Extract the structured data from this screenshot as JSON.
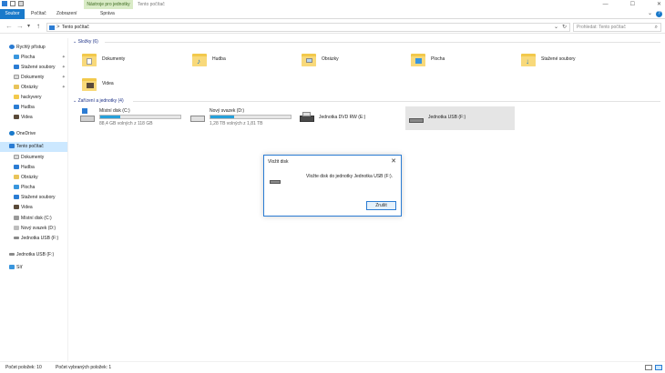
{
  "window": {
    "ribbon_context": "Nástroje pro jednotky",
    "title": "Tento počítač",
    "controls": [
      "—",
      "☐",
      "✕"
    ]
  },
  "ribbon": {
    "tabs": [
      "Soubor",
      "Počítač",
      "Zobrazení",
      "Správa"
    ],
    "help": "?"
  },
  "nav": {
    "back": "←",
    "forward": "→",
    "recent": "▾",
    "up": "↑",
    "address_sep": ">",
    "address": "Tento počítač",
    "refresh": "↻",
    "dropdown": "⌄",
    "search_placeholder": "Prohledat: Tento počítač",
    "search_icon": "⌕"
  },
  "sidebar": {
    "quick_access": "Rychlý přístup",
    "quick_items": [
      {
        "label": "Plocha",
        "pinned": true
      },
      {
        "label": "Stažené soubory",
        "pinned": true
      },
      {
        "label": "Dokumenty",
        "pinned": true
      },
      {
        "label": "Obrázky",
        "pinned": true
      },
      {
        "label": "hackyvery",
        "pinned": false
      },
      {
        "label": "Hudba",
        "pinned": false
      },
      {
        "label": "Videa",
        "pinned": false
      }
    ],
    "onedrive": "OneDrive",
    "this_pc": "Tento počítač",
    "pc_items": [
      "Dokumenty",
      "Hudba",
      "Obrázky",
      "Plocha",
      "Stažené soubory",
      "Videa",
      "Místní disk (C:)",
      "Nový svazek (D:)",
      "Jednotka USB (F:)"
    ],
    "usb": "Jednotka USB (F:)",
    "network": "Síť",
    "pin_glyph": "✦"
  },
  "content": {
    "folders_header": "Složky (6)",
    "folders": [
      "Dokumenty",
      "Hudba",
      "Obrázky",
      "Plocha",
      "Stažené soubory",
      "Videa"
    ],
    "drives_header": "Zařízení a jednotky (4)",
    "drives": [
      {
        "name": "Místní disk (C:)",
        "free": "88,4 GB volných z 118 GB",
        "used_fraction": 0.25
      },
      {
        "name": "Nový svazek (D:)",
        "free": "1,28 TB volných z 1,81 TB",
        "used_fraction": 0.29
      },
      {
        "name": "Jednotka DVD RW (E:)"
      },
      {
        "name": "Jednotka USB (F:)"
      }
    ]
  },
  "dialog": {
    "title": "Vložit disk",
    "close": "✕",
    "message": "Vložte disk do jednotky Jednotka USB (F:).",
    "button": "Zrušit"
  },
  "status": {
    "items_count": "Počet položek: 10",
    "selected_count": "Počet vybraných položek: 1"
  },
  "colors": {
    "accent": "#1979ca",
    "selection": "#cce8ff",
    "drive_bar": "#26a0da",
    "folder": "#f2c94c"
  }
}
